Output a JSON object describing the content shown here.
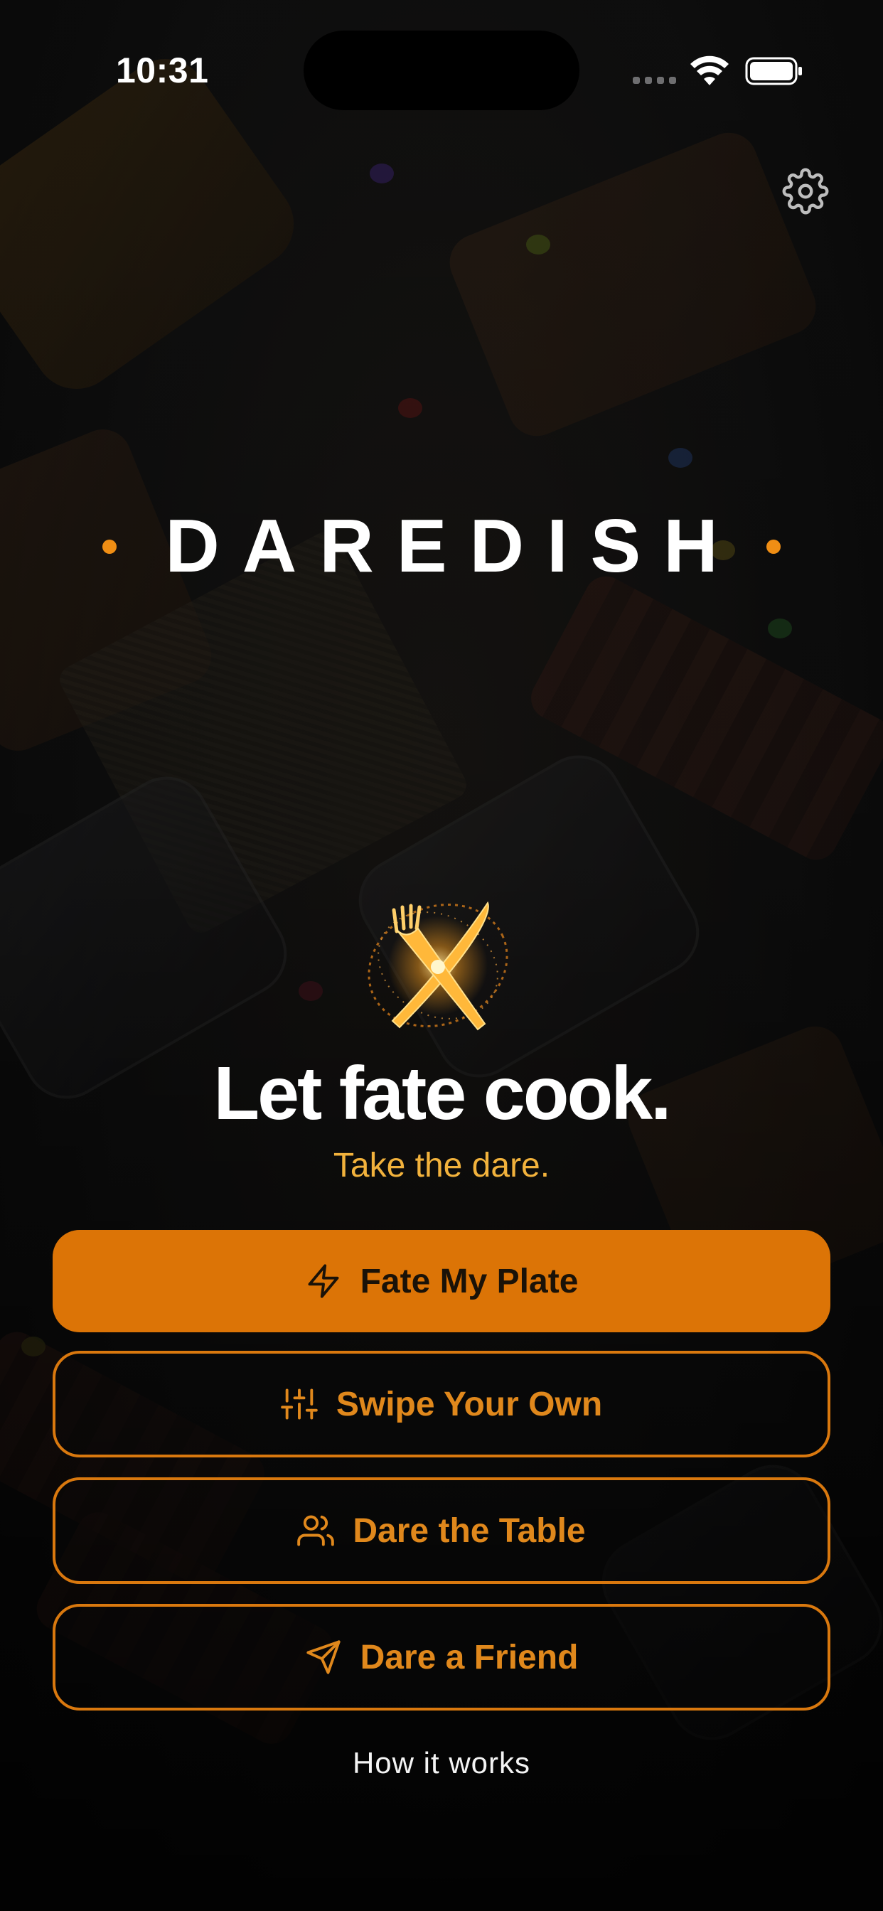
{
  "status": {
    "time": "10:31",
    "icons": [
      "cellular-icon",
      "wifi-icon",
      "battery-icon"
    ]
  },
  "header": {
    "settings_icon": "gear-icon"
  },
  "brand": {
    "name": "DAREDISH",
    "accent": "#f08e14"
  },
  "hero": {
    "logo_icon": "crossed-fork-knife-sparkle-icon",
    "headline": "Let fate cook.",
    "subheadline": "Take the dare."
  },
  "actions": [
    {
      "label": "Fate My Plate",
      "icon": "lightning-icon",
      "style": "primary"
    },
    {
      "label": "Swipe Your Own",
      "icon": "sliders-icon",
      "style": "outline"
    },
    {
      "label": "Dare the Table",
      "icon": "users-icon",
      "style": "outline"
    },
    {
      "label": "Dare a Friend",
      "icon": "send-icon",
      "style": "outline"
    }
  ],
  "footer": {
    "link": "How it works"
  },
  "colors": {
    "primary": "#dc7406",
    "outline": "#d9780e",
    "sub_text": "#f2b23c",
    "background": "#0c0c0d"
  }
}
